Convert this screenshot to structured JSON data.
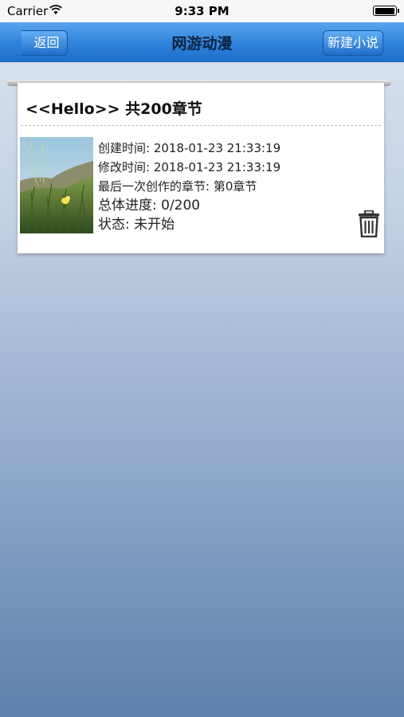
{
  "status_bar": {
    "carrier": "Carrier",
    "time": "9:33 PM"
  },
  "nav": {
    "title": "网游动漫",
    "back_label": "返回",
    "new_label": "新建小说"
  },
  "novel": {
    "title": "<<Hello>> 共200章节",
    "created": "创建时间: 2018-01-23 21:33:19",
    "modified": "修改时间: 2018-01-23 21:33:19",
    "last_chapter": "最后一次创作的章节: 第0章节",
    "progress": "总体进度: 0/200",
    "status": "状态: 未开始"
  },
  "colors": {
    "nav_blue": "#2e82da",
    "title_text": "#0c2240"
  }
}
